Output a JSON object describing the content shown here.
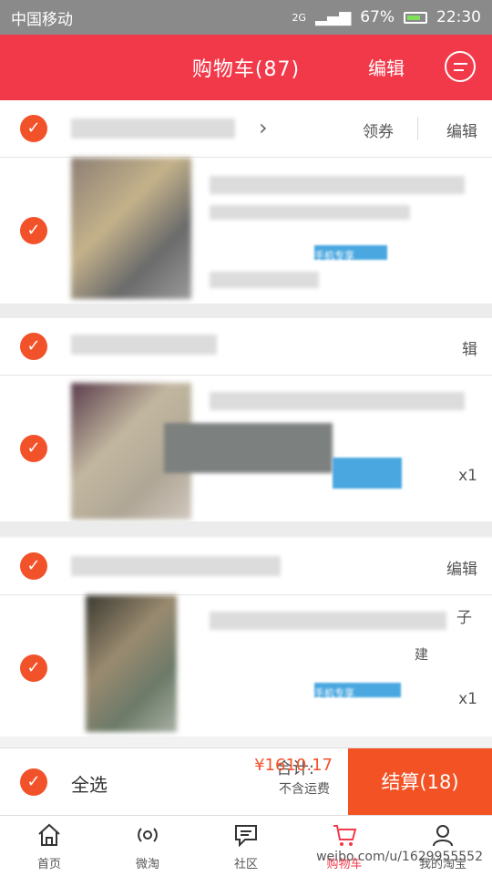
{
  "status_bar": {
    "carrier": "中国移动",
    "network": "2G",
    "battery": "67%",
    "time": "22:30"
  },
  "header": {
    "title": "购物车(87)",
    "edit_label": "编辑"
  },
  "shop1": {
    "coupon_label": "领券",
    "edit_label": "编辑",
    "item_tag": "手机专享"
  },
  "shop2": {
    "edit_label": "辑",
    "quantity": "x1"
  },
  "shop3": {
    "edit_label": "编辑",
    "item_tag": "手机专享",
    "quantity": "x1",
    "partial_a": "子",
    "partial_b": "建"
  },
  "footer": {
    "select_all": "全选",
    "total_label": "合计:",
    "total_value": "¥1610.17",
    "freight_note": "不含运费",
    "checkout_label": "结算(18)"
  },
  "tabs": [
    {
      "label": "首页",
      "icon": "home-icon"
    },
    {
      "label": "微淘",
      "icon": "broadcast-icon"
    },
    {
      "label": "社区",
      "icon": "chat-icon"
    },
    {
      "label": "购物车",
      "icon": "cart-icon"
    },
    {
      "label": "我的淘宝",
      "icon": "user-icon"
    }
  ],
  "watermark": "weibo.com/u/1629955552",
  "colors": {
    "primary": "#f2394a",
    "checkout": "#f25224",
    "check": "#f2522a",
    "tag": "#4aa7e0"
  }
}
